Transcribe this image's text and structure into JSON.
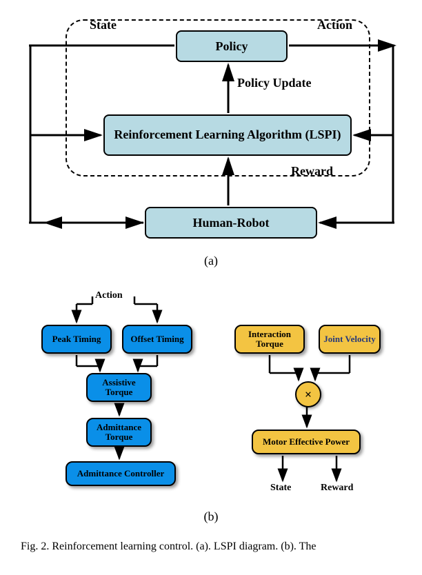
{
  "figA": {
    "state": "State",
    "action": "Action",
    "policy": "Policy",
    "policyUpdate": "Policy Update",
    "lspi": "Reinforcement Learning Algorithm (LSPI)",
    "reward": "Reward",
    "humanRobot": "Human-Robot",
    "sublabel": "(a)"
  },
  "figB": {
    "action": "Action",
    "peak": "Peak Timing",
    "offset": "Offset Timing",
    "assistive": "Assistive Torque",
    "admTorque": "Admittance Torque",
    "admCtrl": "Admittance Controller",
    "interTorque": "Interaction Torque",
    "jointVel": "Joint Velocity",
    "mult": "×",
    "mep": "Motor Effective Power",
    "state": "State",
    "reward": "Reward",
    "sublabel": "(b)"
  },
  "caption": "Fig. 2. Reinforcement learning control. (a). LSPI diagram. (b). The"
}
